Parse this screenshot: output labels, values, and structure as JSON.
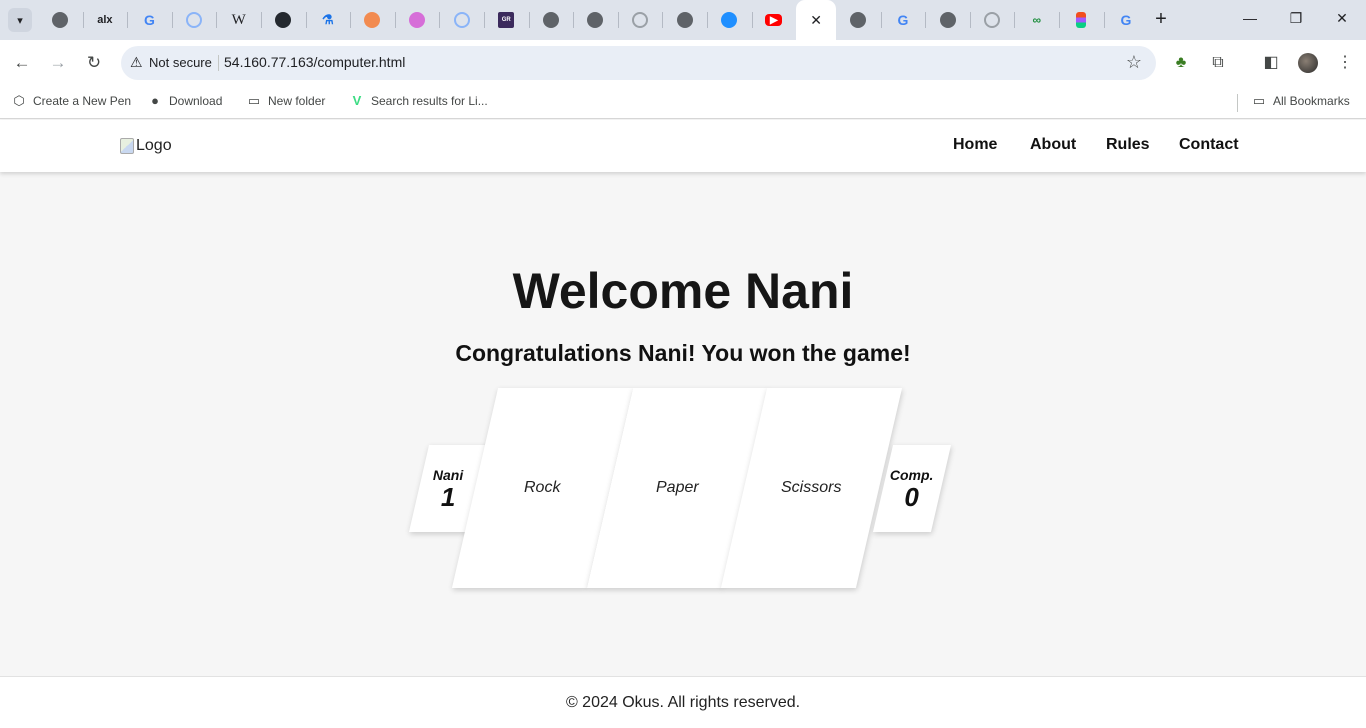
{
  "browser": {
    "tabs": [
      {
        "icon": "globe-icon",
        "glyph": "",
        "cls": "globe"
      },
      {
        "icon": "alx-icon",
        "glyph": "alx",
        "cls": "alx"
      },
      {
        "icon": "google-icon",
        "glyph": "G",
        "cls": "gword"
      },
      {
        "icon": "ring-icon",
        "glyph": "",
        "cls": "ring"
      },
      {
        "icon": "wikipedia-icon",
        "glyph": "W",
        "cls": "wiki"
      },
      {
        "icon": "github-icon",
        "glyph": "",
        "cls": "github"
      },
      {
        "icon": "flask-icon",
        "glyph": "⚗",
        "cls": "flask"
      },
      {
        "icon": "orange-app-icon",
        "glyph": "",
        "cls": "orange"
      },
      {
        "icon": "pink-app-icon",
        "glyph": "",
        "cls": "pink"
      },
      {
        "icon": "ring-icon",
        "glyph": "",
        "cls": "ring"
      },
      {
        "icon": "grok-icon",
        "glyph": "GR",
        "cls": "grok"
      },
      {
        "icon": "globe-icon",
        "glyph": "",
        "cls": "globe"
      },
      {
        "icon": "globe-icon",
        "glyph": "",
        "cls": "globe"
      },
      {
        "icon": "ring-icon",
        "glyph": "",
        "cls": "ring-grey"
      },
      {
        "icon": "globe-icon",
        "glyph": "",
        "cls": "globe"
      },
      {
        "icon": "messenger-icon",
        "glyph": "",
        "cls": "blue"
      },
      {
        "icon": "youtube-icon",
        "glyph": "▶",
        "cls": "youtube"
      },
      {
        "icon": "close-icon",
        "glyph": "✕",
        "cls": "active"
      },
      {
        "icon": "globe-icon",
        "glyph": "",
        "cls": "globe"
      },
      {
        "icon": "google-icon",
        "glyph": "G",
        "cls": "gword"
      },
      {
        "icon": "globe-icon",
        "glyph": "",
        "cls": "globe"
      },
      {
        "icon": "ring-icon",
        "glyph": "",
        "cls": "ring-grey"
      },
      {
        "icon": "green-app-icon",
        "glyph": "∞",
        "cls": "green"
      },
      {
        "icon": "figma-icon",
        "glyph": "",
        "cls": "figma"
      },
      {
        "icon": "google-icon",
        "glyph": "G",
        "cls": "gword"
      }
    ],
    "security_label": "Not secure",
    "url": "54.160.77.163/computer.html",
    "bookmarks": [
      {
        "label": "Create a New Pen",
        "icon": "codepen-icon",
        "glyph": "⬡"
      },
      {
        "label": "Download",
        "icon": "globe-icon",
        "glyph": "●"
      },
      {
        "label": "New folder",
        "icon": "folder-icon",
        "glyph": "▭"
      },
      {
        "label": "Search results for Li...",
        "icon": "vue-icon",
        "glyph": "V"
      }
    ],
    "all_bookmarks_label": "All Bookmarks"
  },
  "page": {
    "logo_alt": "Logo",
    "nav": [
      "Home",
      "About",
      "Rules",
      "Contact"
    ],
    "welcome": "Welcome Nani",
    "result": "Congratulations Nani! You won the game!",
    "player": {
      "name": "Nani",
      "score": "1"
    },
    "computer": {
      "name": "Comp.",
      "score": "0"
    },
    "choices": [
      "Rock",
      "Paper",
      "Scissors"
    ],
    "footer": "© 2024 Okus. All rights reserved."
  }
}
